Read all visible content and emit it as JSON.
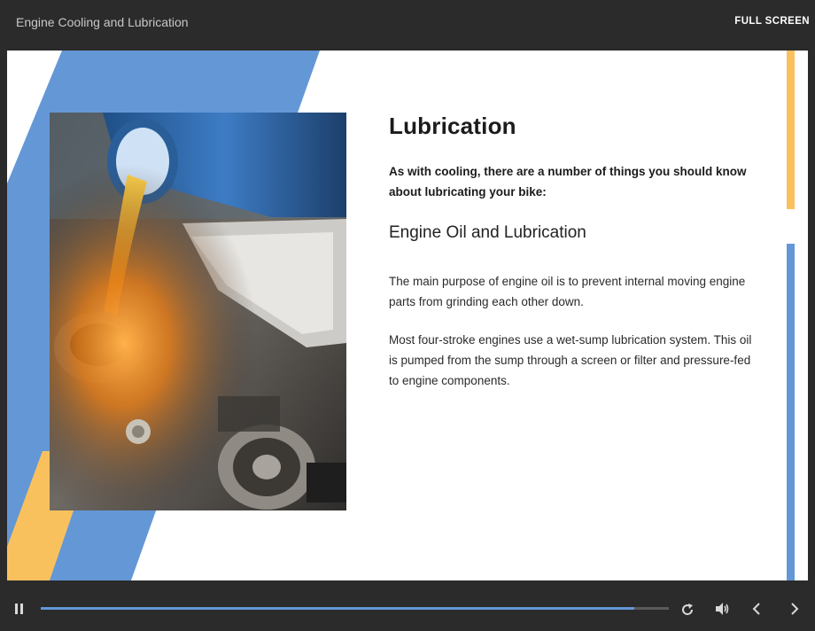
{
  "header": {
    "title": "Engine Cooling and Lubrication",
    "fullscreen_label": "FULL SCREEN"
  },
  "slide": {
    "heading": "Lubrication",
    "intro": "As with cooling, there are a number of things you should know about lubricating your bike:",
    "subheading": "Engine Oil and Lubrication",
    "paragraphs": [
      "The main purpose of engine oil is to prevent internal moving engine parts from grinding each other down.",
      "Most four-stroke engines use a wet-sump lubrication system. This oil is pumped from the sump through a screen or filter and pressure-fed to engine components."
    ],
    "image": "oil-pouring-into-engine-photo"
  },
  "player": {
    "progress_fraction": 0.945,
    "icons": [
      "pause-icon",
      "replay-icon",
      "volume-icon",
      "previous-icon",
      "next-icon"
    ]
  },
  "colors": {
    "accent_blue": "#6497d6",
    "accent_yellow": "#f9c15e",
    "chrome_dark": "#2b2b2b"
  }
}
